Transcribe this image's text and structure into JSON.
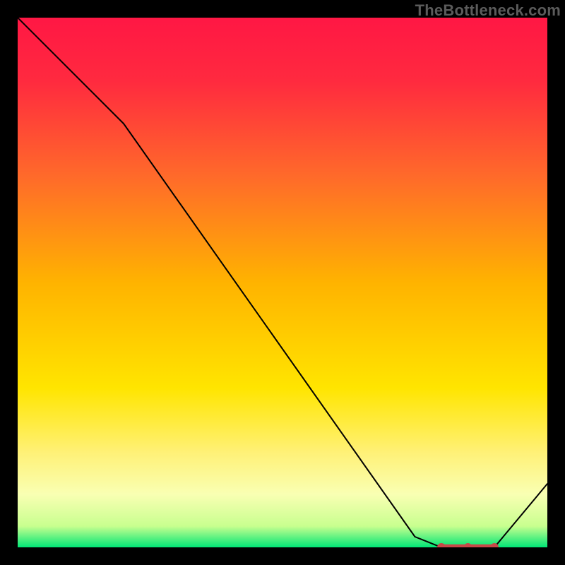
{
  "watermark": "TheBottleneck.com",
  "chart_data": {
    "type": "line",
    "title": "",
    "xlabel": "",
    "ylabel": "",
    "xlim": [
      0,
      100
    ],
    "ylim": [
      0,
      100
    ],
    "x": [
      0,
      20,
      75,
      80,
      85,
      90,
      100
    ],
    "values": [
      100,
      80,
      2,
      0,
      0,
      0,
      12
    ],
    "marker_indices": [
      3,
      4,
      5
    ],
    "style": {
      "line_color": "#000000",
      "line_width": 2,
      "marker_color": "#c84848",
      "marker_size": 6,
      "background_gradient": [
        {
          "offset": 0.0,
          "color": "#ff1744"
        },
        {
          "offset": 0.12,
          "color": "#ff2a3f"
        },
        {
          "offset": 0.3,
          "color": "#ff6a2a"
        },
        {
          "offset": 0.5,
          "color": "#ffb300"
        },
        {
          "offset": 0.7,
          "color": "#ffe500"
        },
        {
          "offset": 0.82,
          "color": "#fff176"
        },
        {
          "offset": 0.9,
          "color": "#f9ffb3"
        },
        {
          "offset": 0.96,
          "color": "#c8ff8f"
        },
        {
          "offset": 1.0,
          "color": "#00e676"
        }
      ]
    }
  }
}
